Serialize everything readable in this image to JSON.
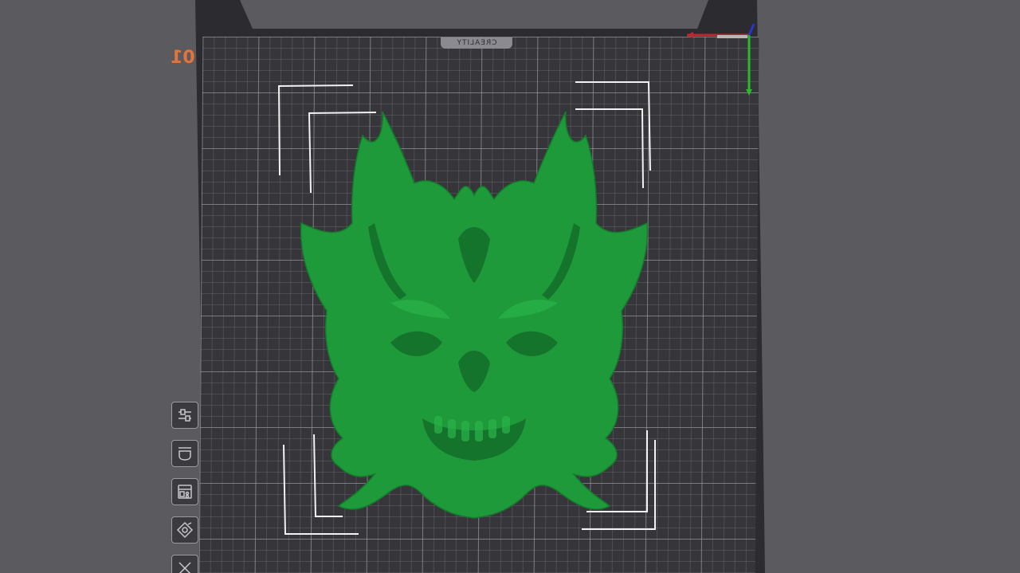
{
  "plate": {
    "brand": "CREALITY",
    "number": "01"
  },
  "model": {
    "color": "#1f9a3a"
  },
  "axis": {
    "x_color": "#c0282d",
    "y_color": "#2eb82e",
    "z_color": "#2a36c8"
  },
  "toolbar": {
    "items": [
      {
        "icon": "settings-sliders-icon"
      },
      {
        "icon": "support-cup-icon"
      },
      {
        "icon": "arrange-grid-icon"
      },
      {
        "icon": "drill-icon"
      },
      {
        "icon": "cut-icon"
      }
    ]
  }
}
